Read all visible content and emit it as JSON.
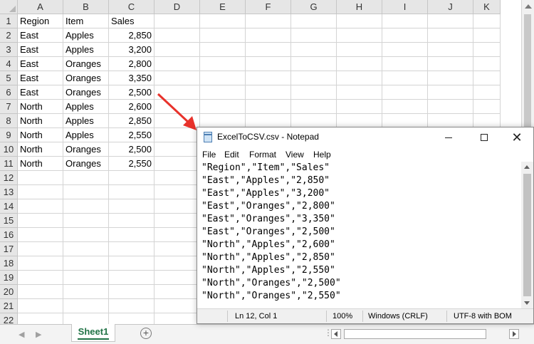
{
  "spreadsheet": {
    "columns": [
      "A",
      "B",
      "C",
      "D",
      "E",
      "F",
      "G",
      "H",
      "I",
      "J",
      "K"
    ],
    "rows": [
      "1",
      "2",
      "3",
      "4",
      "5",
      "6",
      "7",
      "8",
      "9",
      "10",
      "11",
      "12",
      "13",
      "14",
      "15",
      "16",
      "17",
      "18",
      "19",
      "20",
      "21",
      "22"
    ],
    "cells": [
      [
        "Region",
        "Item",
        "Sales"
      ],
      [
        "East",
        "Apples",
        "2,850"
      ],
      [
        "East",
        "Apples",
        "3,200"
      ],
      [
        "East",
        "Oranges",
        "2,800"
      ],
      [
        "East",
        "Oranges",
        "3,350"
      ],
      [
        "East",
        "Oranges",
        "2,500"
      ],
      [
        "North",
        "Apples",
        "2,600"
      ],
      [
        "North",
        "Apples",
        "2,850"
      ],
      [
        "North",
        "Apples",
        "2,550"
      ],
      [
        "North",
        "Oranges",
        "2,500"
      ],
      [
        "North",
        "Oranges",
        "2,550"
      ]
    ],
    "sheet_tab": "Sheet1",
    "add_sheet_symbol": "+",
    "accent_color": "#217346"
  },
  "notepad": {
    "title": "ExcelToCSV.csv - Notepad",
    "menu": [
      "File",
      "Edit",
      "Format",
      "View",
      "Help"
    ],
    "content": "\"Region\",\"Item\",\"Sales\"\n\"East\",\"Apples\",\"2,850\"\n\"East\",\"Apples\",\"3,200\"\n\"East\",\"Oranges\",\"2,800\"\n\"East\",\"Oranges\",\"3,350\"\n\"East\",\"Oranges\",\"2,500\"\n\"North\",\"Apples\",\"2,600\"\n\"North\",\"Apples\",\"2,850\"\n\"North\",\"Apples\",\"2,550\"\n\"North\",\"Oranges\",\"2,500\"\n\"North\",\"Oranges\",\"2,550\"",
    "status": {
      "position": "Ln 12, Col 1",
      "zoom": "100%",
      "line_ending": "Windows (CRLF)",
      "encoding": "UTF-8 with BOM"
    },
    "window_buttons": {
      "close": "✕"
    }
  },
  "annotation": {
    "arrow_color": "#e8322b"
  }
}
